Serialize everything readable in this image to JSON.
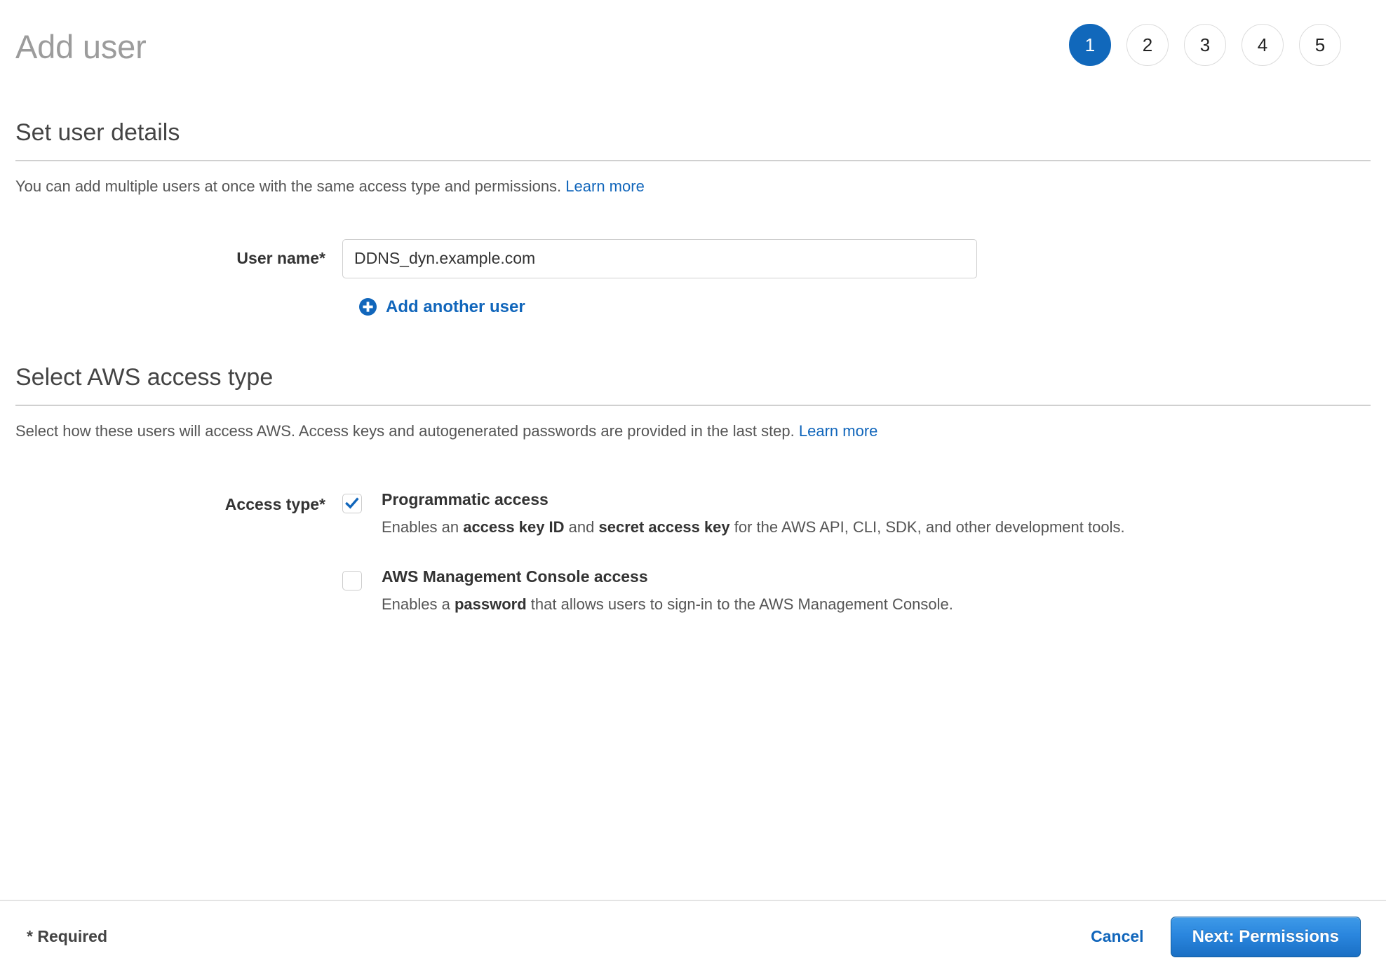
{
  "header": {
    "title": "Add user",
    "steps": [
      {
        "label": "1",
        "active": true
      },
      {
        "label": "2",
        "active": false
      },
      {
        "label": "3",
        "active": false
      },
      {
        "label": "4",
        "active": false
      },
      {
        "label": "5",
        "active": false
      }
    ]
  },
  "user_details": {
    "heading": "Set user details",
    "description": "You can add multiple users at once with the same access type and permissions.",
    "learn_more": "Learn more",
    "username_label": "User name*",
    "username_value": "DDNS_dyn.example.com",
    "username_placeholder": "",
    "add_another_label": "Add another user",
    "add_another_icon": "plus-circle-icon"
  },
  "access_type": {
    "heading": "Select AWS access type",
    "description": "Select how these users will access AWS. Access keys and autogenerated passwords are provided in the last step.",
    "learn_more": "Learn more",
    "label": "Access type*",
    "options": [
      {
        "title": "Programmatic access",
        "checked": true,
        "desc_parts": [
          {
            "text": "Enables an ",
            "bold": false
          },
          {
            "text": "access key ID",
            "bold": true
          },
          {
            "text": " and ",
            "bold": false
          },
          {
            "text": "secret access key",
            "bold": true
          },
          {
            "text": " for the AWS API, CLI, SDK, and other development tools.",
            "bold": false
          }
        ],
        "desc_plain": "Enables an access key ID and secret access key for the AWS API, CLI, SDK, and other development tools."
      },
      {
        "title": "AWS Management Console access",
        "checked": false,
        "desc_parts": [
          {
            "text": "Enables a ",
            "bold": false
          },
          {
            "text": "password",
            "bold": true
          },
          {
            "text": " that allows users to sign-in to the AWS Management Console.",
            "bold": false
          }
        ],
        "desc_plain": "Enables a password that allows users to sign-in to the AWS Management Console."
      }
    ]
  },
  "footer": {
    "required_note": "* Required",
    "cancel_label": "Cancel",
    "next_label": "Next: Permissions"
  },
  "colors": {
    "accent_blue": "#1166bb",
    "step_active": "#1168bb",
    "button_blue_top": "#3e9ae8",
    "button_blue_bottom": "#1a6fc4",
    "title_gray": "#9c9c9c",
    "divider_gray": "#d0d0d0"
  }
}
